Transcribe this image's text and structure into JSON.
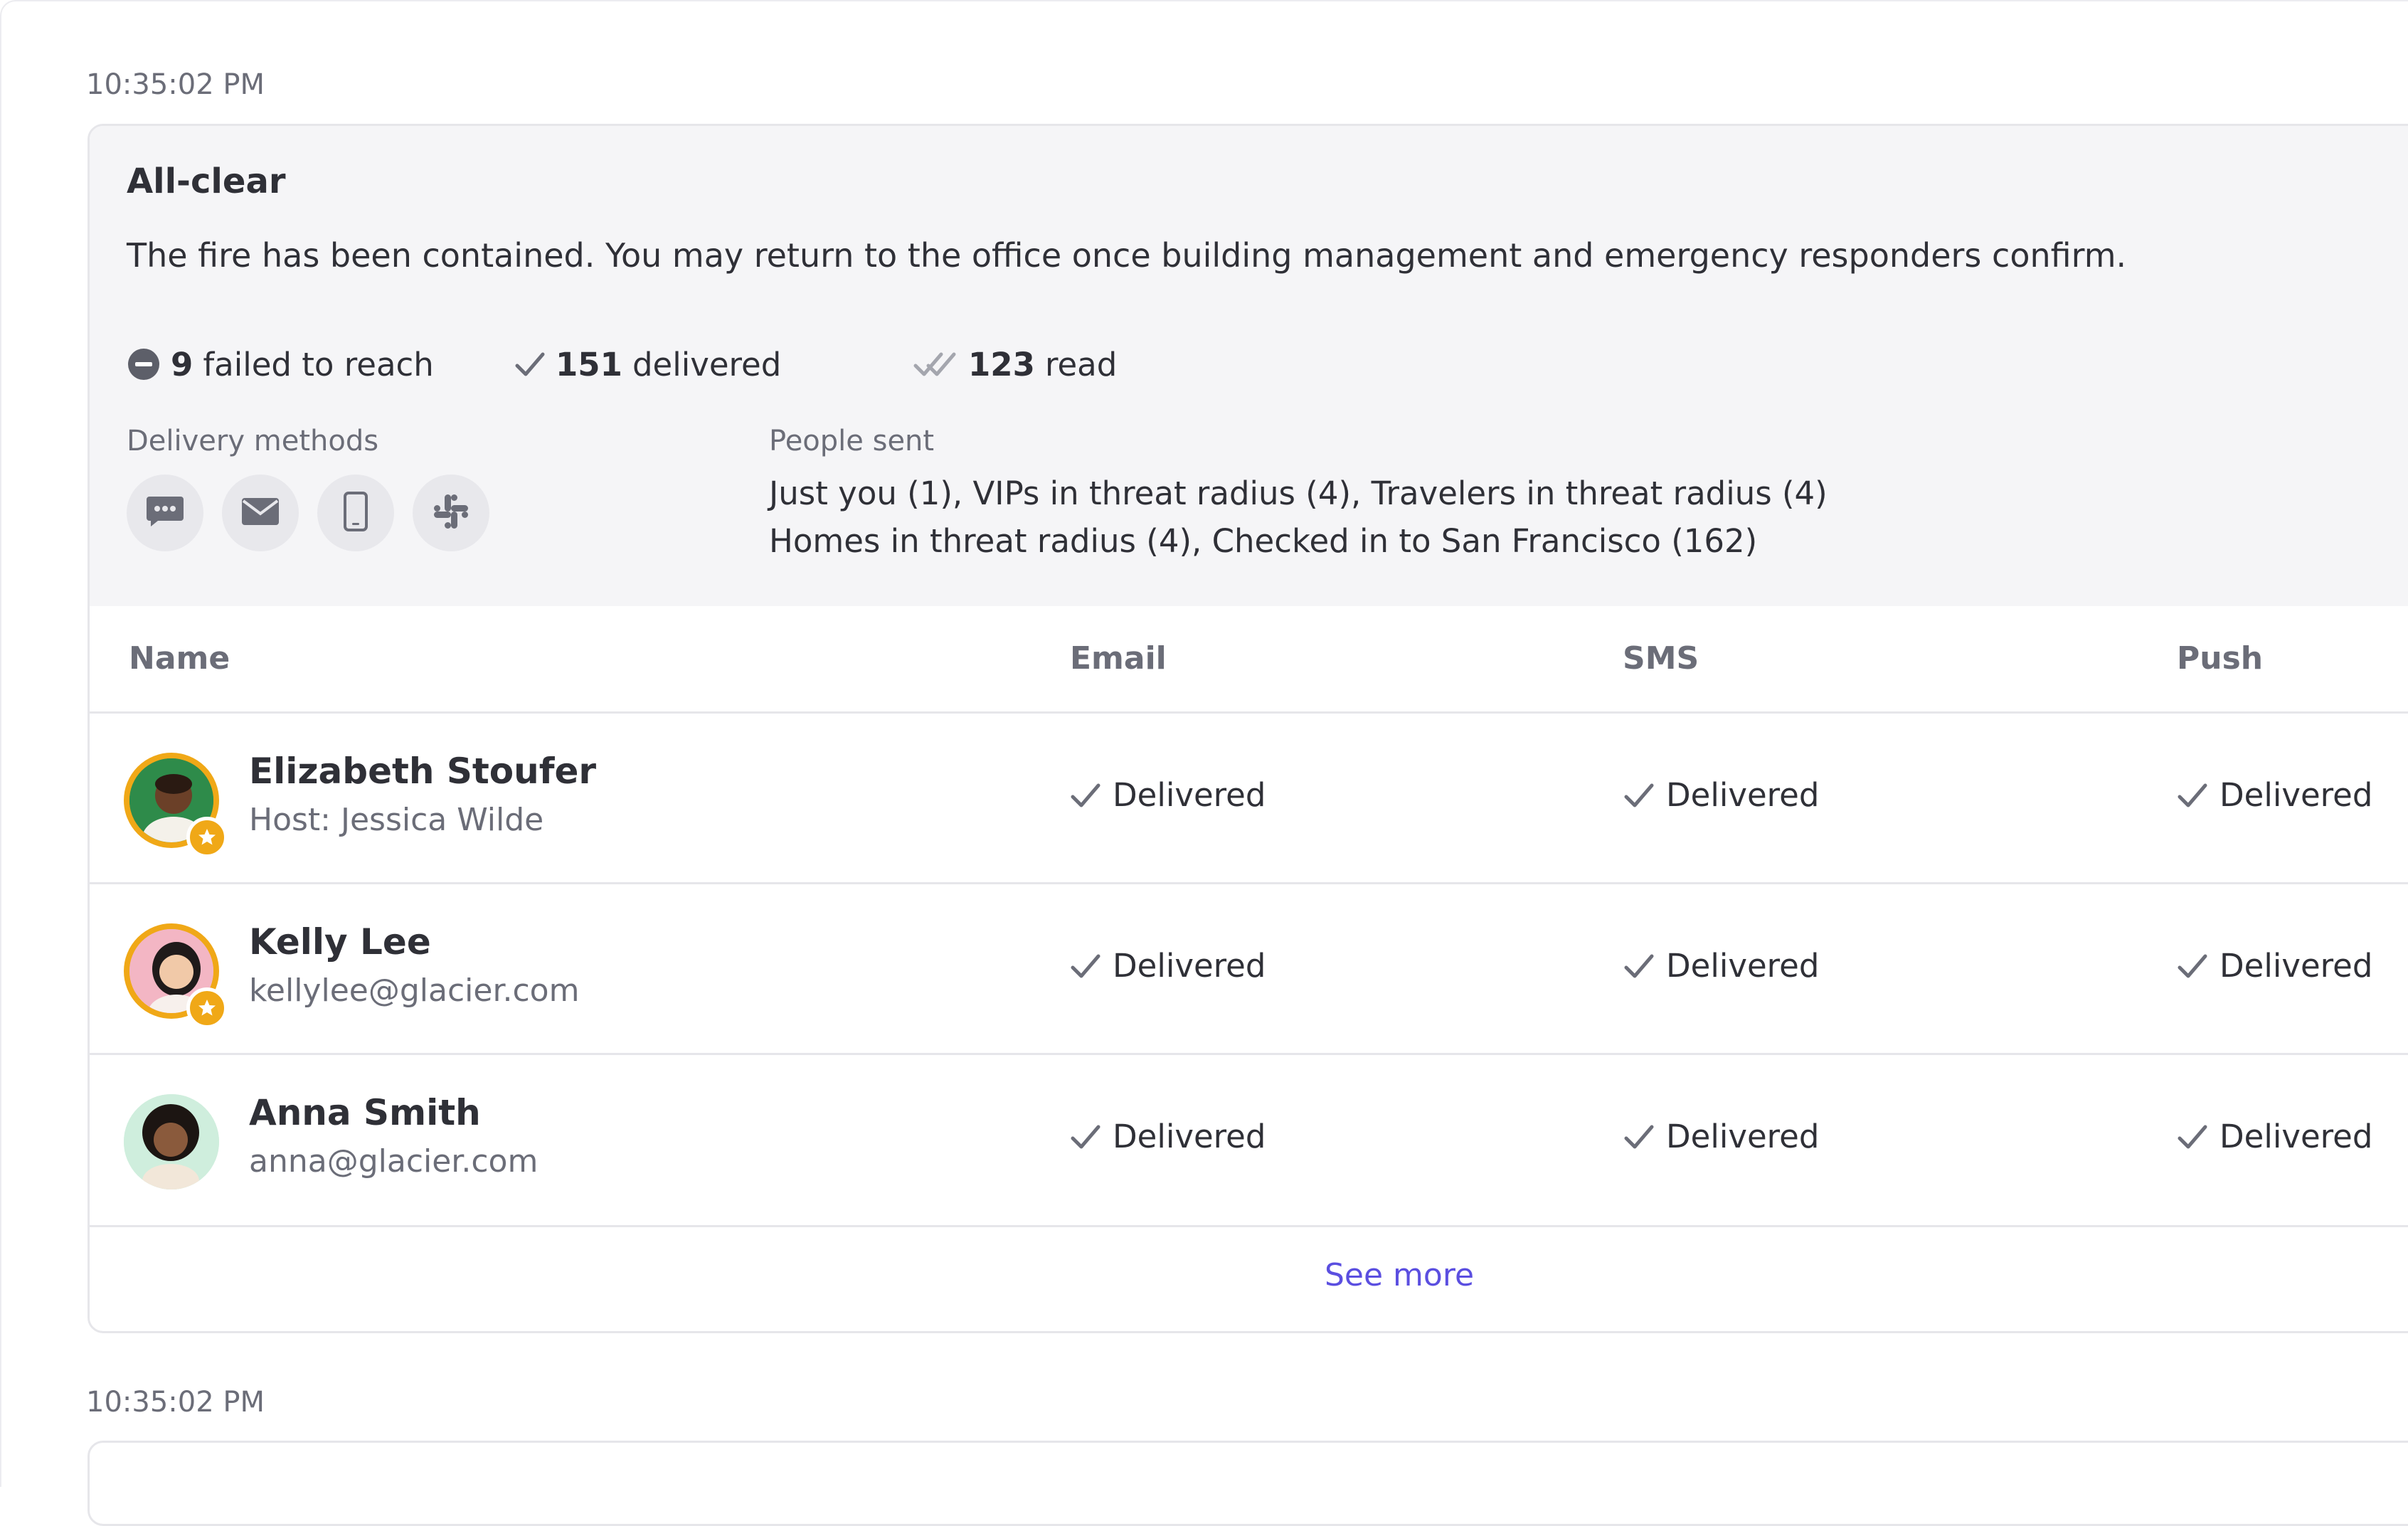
{
  "entries": [
    {
      "timestamp": "10:35:02 PM",
      "title": "All-clear",
      "message": "The fire has been contained. You may return to the office once building management and emergency responders confirm.",
      "stats": {
        "failed_count": "9",
        "failed_label": "failed to reach",
        "delivered_count": "151",
        "delivered_label": "delivered",
        "read_count": "123",
        "read_label": "read"
      },
      "delivery_methods_label": "Delivery methods",
      "delivery_methods": [
        "sms-icon",
        "email-icon",
        "mobile-push-icon",
        "slack-icon"
      ],
      "people_sent_label": "People sent",
      "people_sent_lines": [
        "Just you (1), VIPs in threat radius (4), Travelers in threat radius (4)",
        "Homes in threat radius (4), Checked in to San Francisco (162)"
      ],
      "table": {
        "columns": [
          "Name",
          "Email",
          "SMS",
          "Push"
        ],
        "rows": [
          {
            "name": "Elizabeth Stoufer",
            "sub": "Host: Jessica Wilde",
            "vip": true,
            "email": "Delivered",
            "sms": "Delivered",
            "push": "Delivered"
          },
          {
            "name": "Kelly Lee",
            "sub": "kellylee@glacier.com",
            "vip": true,
            "email": "Delivered",
            "sms": "Delivered",
            "push": "Delivered"
          },
          {
            "name": "Anna Smith",
            "sub": "anna@glacier.com",
            "vip": false,
            "email": "Delivered",
            "sms": "Delivered",
            "push": "Delivered"
          }
        ]
      },
      "see_more": "See more"
    },
    {
      "timestamp": "10:35:02 PM"
    }
  ],
  "colors": {
    "accent_link": "#5b4fe0",
    "vip_ring": "#f0a817",
    "header_bg": "#f5f5f7",
    "muted_text": "#6b6d78"
  }
}
